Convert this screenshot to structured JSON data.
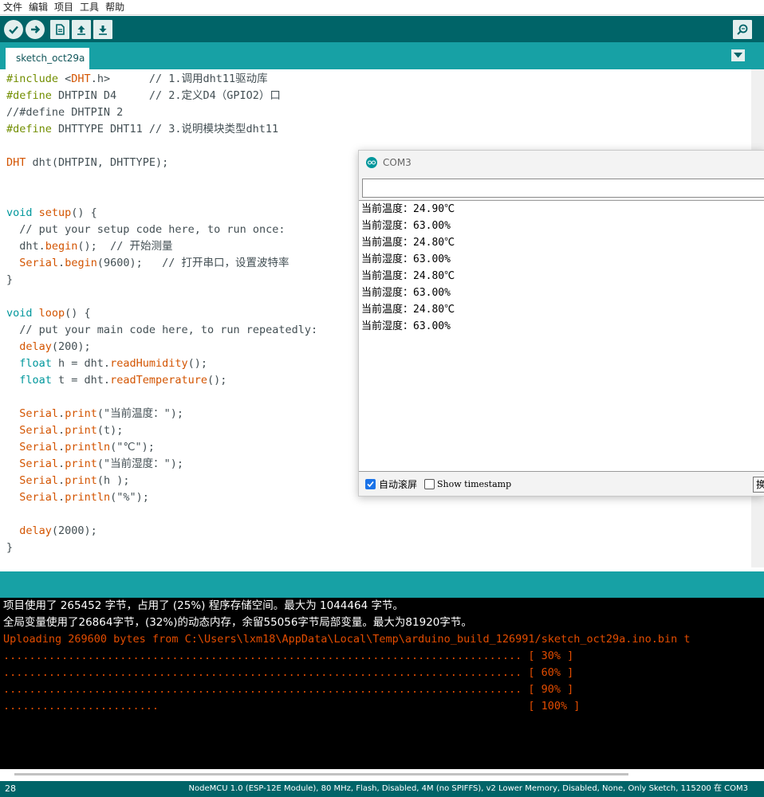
{
  "menu": [
    "文件",
    "编辑",
    "项目",
    "工具",
    "帮助"
  ],
  "toolbar": {
    "buttons": [
      "verify-icon",
      "upload-icon",
      "new-icon",
      "open-icon",
      "save-icon"
    ],
    "right": "serial-monitor-icon"
  },
  "tabs": [
    {
      "label": "sketch_oct29a"
    }
  ],
  "code_lines": [
    "#include <DHT.h>      // 1.调用dht11驱动库",
    "#define DHTPIN D4     // 2.定义D4（GPIO2）口",
    "//#define DHTPIN 2",
    "#define DHTTYPE DHT11 // 3.说明模块类型dht11",
    "",
    "DHT dht(DHTPIN, DHTTYPE);",
    "",
    "",
    "void setup() {",
    "  // put your setup code here, to run once:",
    "  dht.begin();  // 开始测量",
    "  Serial.begin(9600);   // 打开串口，设置波特率",
    "}",
    "",
    "void loop() {",
    "  // put your main code here, to run repeatedly:",
    "  delay(200);",
    "  float h = dht.readHumidity();",
    "  float t = dht.readTemperature();",
    "",
    "  Serial.print(\"当前温度：\");",
    "  Serial.print(t);",
    "  Serial.println(\"℃\");",
    "  Serial.print(\"当前湿度：\");",
    "  Serial.print(h );",
    "  Serial.println(\"%\");",
    "",
    "  delay(2000);",
    "}"
  ],
  "serial_monitor": {
    "title": "COM3",
    "input_value": "",
    "output": [
      "当前温度：24.90℃",
      "当前湿度：63.00%",
      "当前温度：24.80℃",
      "当前湿度：63.00%",
      "当前温度：24.80℃",
      "当前湿度：63.00%",
      "当前温度：24.80℃",
      "当前湿度：63.00%"
    ],
    "autoscroll_label": "自动滚屏",
    "autoscroll_checked": true,
    "timestamp_label": "Show timestamp",
    "timestamp_checked": false,
    "line_ending_label": "换"
  },
  "console": {
    "lines": [
      {
        "text": "项目使用了 265452 字节，占用了 (25%) 程序存储空间。最大为 1044464 字节。",
        "color": "white"
      },
      {
        "text": "全局变量使用了26864字节，(32%)的动态内存，余留55056字节局部变量。最大为81920字节。",
        "color": "white"
      },
      {
        "text": "Uploading 269600 bytes from C:\\Users\\lxm18\\AppData\\Local\\Temp\\arduino_build_126991/sketch_oct29a.ino.bin t",
        "color": "orange"
      },
      {
        "text": "................................................................................ [ 30% ]",
        "color": "orange"
      },
      {
        "text": "................................................................................ [ 60% ]",
        "color": "orange"
      },
      {
        "text": "................................................................................ [ 90% ]",
        "color": "orange"
      },
      {
        "text": "........................                                                         [ 100% ]",
        "color": "orange"
      }
    ]
  },
  "status": {
    "line_number": "28",
    "board": "NodeMCU 1.0 (ESP-12E Module), 80 MHz, Flash, Disabled, 4M (no SPIFFS), v2 Lower Memory, Disabled, None, Only Sketch, 115200 在 COM3"
  },
  "colors": {
    "toolbar": "#006468",
    "tabstrip": "#17a1a5",
    "console_text": "#e34c00"
  }
}
